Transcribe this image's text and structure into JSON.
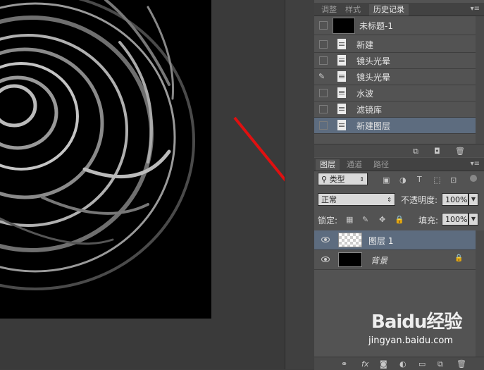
{
  "history_panel": {
    "tabs": [
      "调整",
      "样式",
      "历史记录"
    ],
    "snapshot_label": "未标题-1",
    "items": [
      "新建",
      "镜头光晕",
      "镜头光晕",
      "水波",
      "滤镜库",
      "新建图层"
    ]
  },
  "layers_panel": {
    "tabs": [
      "图层",
      "通道",
      "路径"
    ],
    "filter_kind": "类型",
    "blend_mode": "正常",
    "opacity_label": "不透明度:",
    "opacity_value": "100%",
    "lock_label": "锁定:",
    "fill_label": "填充:",
    "fill_value": "100%",
    "layers": [
      {
        "name": "图层 1",
        "selected": true
      },
      {
        "name": "背景",
        "locked": true
      }
    ]
  },
  "watermark": {
    "brand": "Baidu经验",
    "url": "jingyan.baidu.com"
  },
  "colors": {
    "annotation": "#e01010",
    "selected_row": "#5d6c7f",
    "panel_bg": "#535353"
  }
}
